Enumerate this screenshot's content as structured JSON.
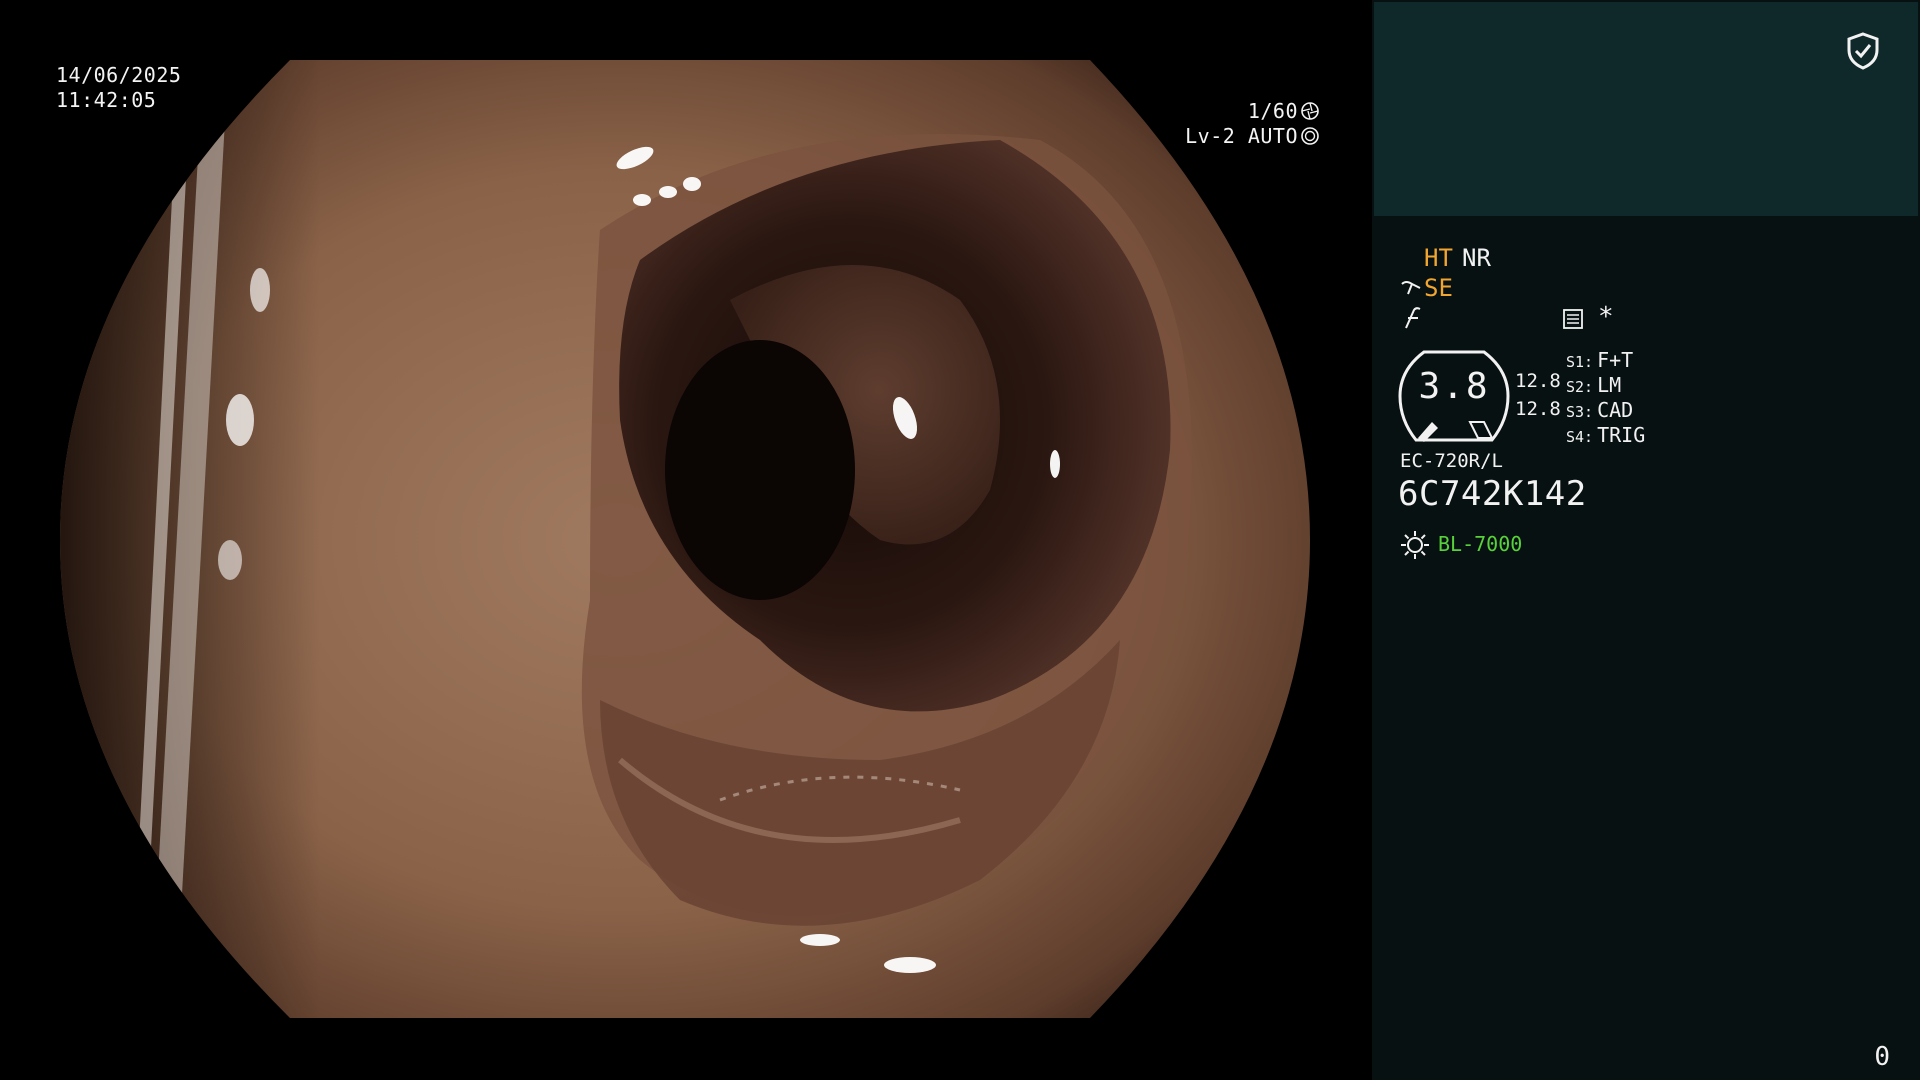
{
  "overlay": {
    "date": "14/06/2025",
    "time": "11:42:05",
    "shutter": "1/60",
    "level_auto": "Lv-2 AUTO"
  },
  "panel": {
    "modes": {
      "ht": "HT",
      "nr": "NR",
      "se": "SE"
    },
    "asterisk": "*",
    "gauge": {
      "value": "3.8",
      "line1": "12.8",
      "line2": "12.8"
    },
    "switches": [
      {
        "key": "S1:",
        "value": "F+T"
      },
      {
        "key": "S2:",
        "value": "LM"
      },
      {
        "key": "S3:",
        "value": "CAD"
      },
      {
        "key": "S4:",
        "value": "TRIG"
      }
    ],
    "scope_model": "EC-720R/L",
    "scope_serial": "6C742K142",
    "light_source": "BL-7000",
    "counter": "0"
  },
  "icons": {
    "shield": "shield-check-icon",
    "shutter": "aperture-icon",
    "auto_iris": "iris-icon",
    "enhancement": "scope-enhance-icon",
    "freeze": "freeze-icon",
    "menu": "menu-list-icon",
    "light": "sun-light-icon"
  },
  "colors": {
    "panel_background": "#081112",
    "panel_header": "#0f2829",
    "mode_accent": "#f0a630",
    "light_status": "#58d23a"
  }
}
